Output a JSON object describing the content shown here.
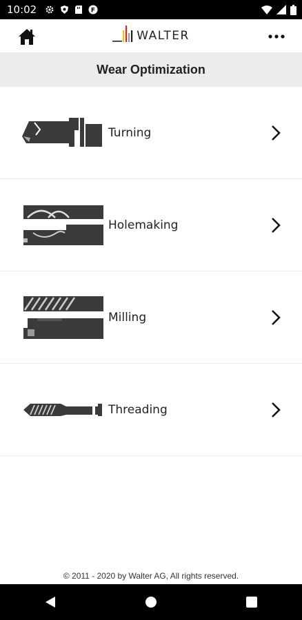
{
  "status_bar": {
    "time": "10:02",
    "icons": [
      "gear-icon",
      "shield-icon",
      "sd-card-icon",
      "app-notification-icon",
      "wifi-icon",
      "cell-signal-icon",
      "battery-icon"
    ]
  },
  "header": {
    "logo_text": "WALTER",
    "home_icon": "home-icon",
    "more_icon": "more-icon"
  },
  "page": {
    "title": "Wear Optimization"
  },
  "categories": [
    {
      "label": "Turning",
      "icon": "turning-tool-image"
    },
    {
      "label": "Holemaking",
      "icon": "holemaking-tool-image"
    },
    {
      "label": "Milling",
      "icon": "milling-tool-image"
    },
    {
      "label": "Threading",
      "icon": "threading-tool-image"
    }
  ],
  "footer": {
    "copyright": "© 2011 - 2020 by Walter AG, All rights reserved."
  },
  "nav_bar": {
    "icons": [
      "back-icon",
      "home-circle-icon",
      "recents-icon"
    ]
  },
  "colors": {
    "logo_stripes": [
      "#f4c20d",
      "#e2231a",
      "#9b9b9b"
    ],
    "title_bar_bg": "#ececec",
    "tool_gray": "#3a3a3a"
  }
}
